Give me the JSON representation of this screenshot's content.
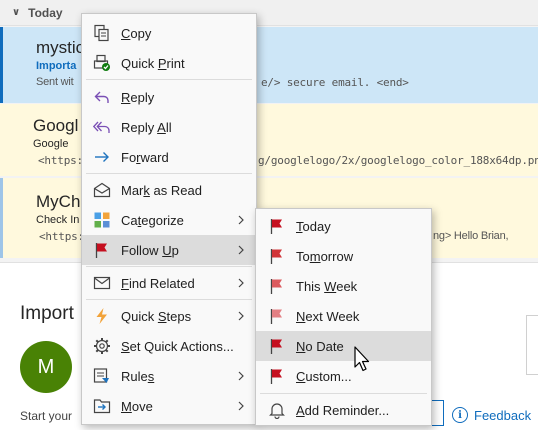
{
  "mail_list": {
    "group": {
      "label": "Today"
    },
    "messages": [
      {
        "from": "mystic",
        "subject": "Importa",
        "preview": "Sent wit",
        "preview_right": "e/>  secure email.  <end>"
      },
      {
        "from": "Googl",
        "subject": "Google",
        "preview": "<https:",
        "preview_right": "g/googlelogo/2x/googlelogo_color_188x64dp.png"
      },
      {
        "from": "MyCha",
        "subject": "Check In",
        "preview": "<https:",
        "preview_right": "ng>  Hello Brian,"
      }
    ]
  },
  "reading_pane": {
    "title": "Import",
    "avatar_initial": "M",
    "body_start": "Start your",
    "feedback_label": "Feedback",
    "accent_color": "#0f6cbd"
  },
  "context_menu": {
    "items": [
      {
        "pre": "",
        "ul": "C",
        "post": "opy",
        "icon": "copy-icon"
      },
      {
        "pre": "Quick ",
        "ul": "P",
        "post": "rint",
        "icon": "quick-print-icon"
      },
      {
        "pre": "",
        "ul": "R",
        "post": "eply",
        "icon": "reply-icon"
      },
      {
        "pre": "Reply ",
        "ul": "A",
        "post": "ll",
        "icon": "reply-all-icon"
      },
      {
        "pre": "Fo",
        "ul": "r",
        "post": "ward",
        "icon": "forward-icon"
      },
      {
        "pre": "Mar",
        "ul": "k",
        "post": " as Read",
        "icon": "envelope-open-icon"
      },
      {
        "pre": "Ca",
        "ul": "t",
        "post": "egorize",
        "icon": "categorize-icon"
      },
      {
        "pre": "Follow ",
        "ul": "U",
        "post": "p",
        "icon": "flag-icon"
      },
      {
        "pre": "",
        "ul": "F",
        "post": "ind Related",
        "icon": "find-related-icon"
      },
      {
        "pre": "Quick ",
        "ul": "S",
        "post": "teps",
        "icon": "lightning-icon"
      },
      {
        "pre": "",
        "ul": "S",
        "post": "et Quick Actions...",
        "icon": "gear-icon"
      },
      {
        "pre": "Rule",
        "ul": "s",
        "post": "",
        "icon": "rules-icon"
      },
      {
        "pre": "",
        "ul": "M",
        "post": "ove",
        "icon": "move-icon"
      }
    ]
  },
  "followup_submenu": {
    "items": [
      {
        "pre": "",
        "ul": "T",
        "post": "oday",
        "icon": "flag-icon"
      },
      {
        "pre": "To",
        "ul": "m",
        "post": "orrow",
        "icon": "flag-icon"
      },
      {
        "pre": "This ",
        "ul": "W",
        "post": "eek",
        "icon": "flag-icon"
      },
      {
        "pre": "",
        "ul": "N",
        "post": "ext Week",
        "icon": "flag-icon"
      },
      {
        "pre": "",
        "ul": "N",
        "post": "o Date",
        "icon": "flag-icon"
      },
      {
        "pre": "",
        "ul": "C",
        "post": "ustom...",
        "icon": "flag-icon"
      },
      {
        "pre": "",
        "ul": "A",
        "post": "dd Reminder...",
        "icon": "bell-icon"
      }
    ]
  },
  "colors": {
    "flag_red": "#c50f1f",
    "hover_gray": "#dcdcdc",
    "unread_blue": "#0f6cbd"
  }
}
